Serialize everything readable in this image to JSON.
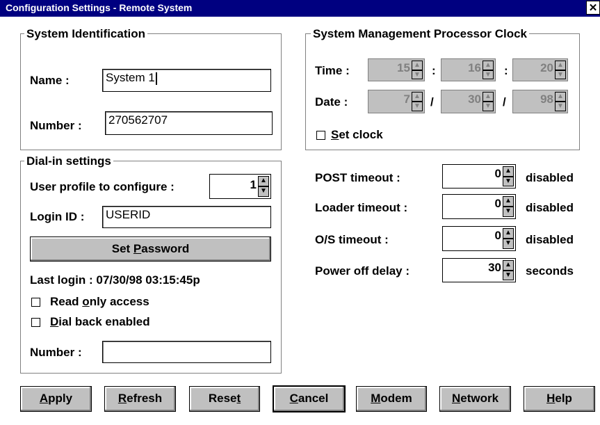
{
  "window": {
    "title": "Configuration Settings - Remote System",
    "close_glyph": "✕"
  },
  "system_identification": {
    "legend": "System Identification",
    "name_label": "Name :",
    "name_value": "System 1",
    "number_label": "Number :",
    "number_value": "270562707"
  },
  "clock": {
    "legend": "System Management Processor Clock",
    "time_label": "Time :",
    "time_h": "15",
    "time_m": "16",
    "time_s": "20",
    "time_sep": ":",
    "date_label": "Date :",
    "date_m": "7",
    "date_d": "30",
    "date_y": "98",
    "date_sep": "/",
    "set_clock_pre": "",
    "set_clock_u": "S",
    "set_clock_post": "et clock"
  },
  "dialin": {
    "legend": "Dial-in settings",
    "profile_label": "User profile to configure :",
    "profile_value": "1",
    "login_label": "Login ID :",
    "login_value": "USERID",
    "set_password_pre": "Set ",
    "set_password_u": "P",
    "set_password_post": "assword",
    "last_login": "Last login :  07/30/98  03:15:45p",
    "read_only_pre": "Read ",
    "read_only_u": "o",
    "read_only_post": "nly access",
    "dial_back_pre": "",
    "dial_back_u": "D",
    "dial_back_post": "ial back enabled",
    "number_label": "Number :",
    "number_value": ""
  },
  "timeouts": {
    "post_label": "POST timeout :",
    "post_value": "0",
    "post_unit": "disabled",
    "loader_label": "Loader timeout :",
    "loader_value": "0",
    "loader_unit": "disabled",
    "os_label": "O/S timeout :",
    "os_value": "0",
    "os_unit": "disabled",
    "power_label": "Power off delay :",
    "power_value": "30",
    "power_unit": "seconds"
  },
  "buttons": {
    "apply_u": "A",
    "apply_post": "pply",
    "refresh_u": "R",
    "refresh_post": "efresh",
    "reset_pre": "Rese",
    "reset_u": "t",
    "cancel_u": "C",
    "cancel_post": "ancel",
    "modem_u": "M",
    "modem_post": "odem",
    "network_u": "N",
    "network_post": "etwork",
    "help_u": "H",
    "help_post": "elp"
  },
  "icons": {
    "up_arrow": "▲",
    "down_arrow": "▼"
  }
}
